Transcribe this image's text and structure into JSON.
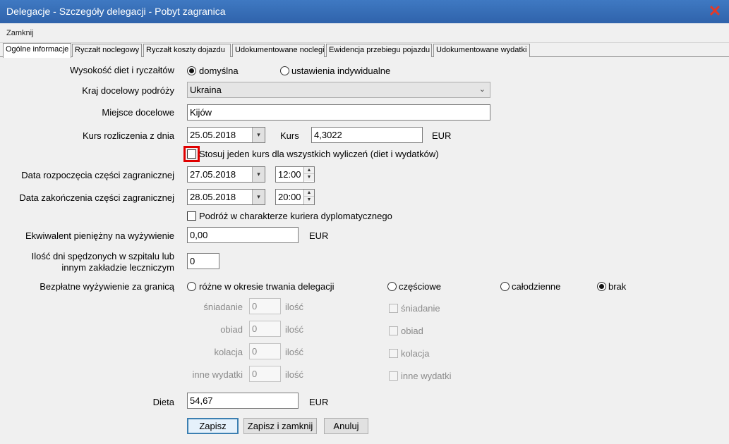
{
  "window": {
    "title": "Delegacje - Szczegóły delegacji - Pobyt zagranica",
    "close_icon": "close-x-icon"
  },
  "menu": {
    "close_label": "Zamknij"
  },
  "tabs": [
    "Ogólne informacje",
    "Ryczałt noclegowy",
    "Ryczałt koszty dojazdu",
    "Udokumentowane noclegi",
    "Ewidencja przebiegu pojazdu",
    "Udokumentowane wydatki"
  ],
  "form": {
    "rates": {
      "label": "Wysokość diet i ryczałtów",
      "opt_default": "domyślna",
      "opt_custom": "ustawienia indywidualne",
      "selected": "domyślna"
    },
    "country": {
      "label": "Kraj docelowy podróży",
      "value": "Ukraina"
    },
    "place": {
      "label": "Miejsce docelowe",
      "value": "Kijów"
    },
    "rate_date": {
      "label": "Kurs rozliczenia z dnia",
      "value": "25.05.2018",
      "kurs_label": "Kurs",
      "kurs_value": "4,3022",
      "currency": "EUR"
    },
    "single_rate": {
      "label": "Stosuj jeden kurs dla wszystkich wyliczeń (diet i wydatków)",
      "checked": false
    },
    "start": {
      "label": "Data rozpoczęcia części zagranicznej",
      "date": "27.05.2018",
      "time": "12:00"
    },
    "end": {
      "label": "Data zakończenia części zagranicznej",
      "date": "28.05.2018",
      "time": "20:00"
    },
    "courier": {
      "label": "Podróż w charakterze kuriera dyplomatycznego",
      "checked": false
    },
    "food_equiv": {
      "label": "Ekwiwalent pieniężny na wyżywienie",
      "value": "0,00",
      "currency": "EUR"
    },
    "hospital": {
      "label_line1": "Ilość dni spędzonych w szpitalu lub",
      "label_line2": "innym zakładzie leczniczym",
      "value": "0"
    },
    "free_food": {
      "label": "Bezpłatne wyżywienie za granicą",
      "opt_varied": "różne w okresie trwania delegacji",
      "opt_partial": "częściowe",
      "opt_full": "całodzienne",
      "opt_none": "brak",
      "selected": "brak",
      "meals": [
        {
          "label": "śniadanie",
          "qty": "0",
          "qty_label": "ilość",
          "check_label": "śniadanie"
        },
        {
          "label": "obiad",
          "qty": "0",
          "qty_label": "ilość",
          "check_label": "obiad"
        },
        {
          "label": "kolacja",
          "qty": "0",
          "qty_label": "ilość",
          "check_label": "kolacja"
        },
        {
          "label": "inne wydatki",
          "qty": "0",
          "qty_label": "ilość",
          "check_label": "inne wydatki"
        }
      ]
    },
    "diet": {
      "label": "Dieta",
      "value": "54,67",
      "currency": "EUR"
    }
  },
  "buttons": {
    "save": "Zapisz",
    "save_close": "Zapisz i zamknij",
    "cancel": "Anuluj"
  }
}
